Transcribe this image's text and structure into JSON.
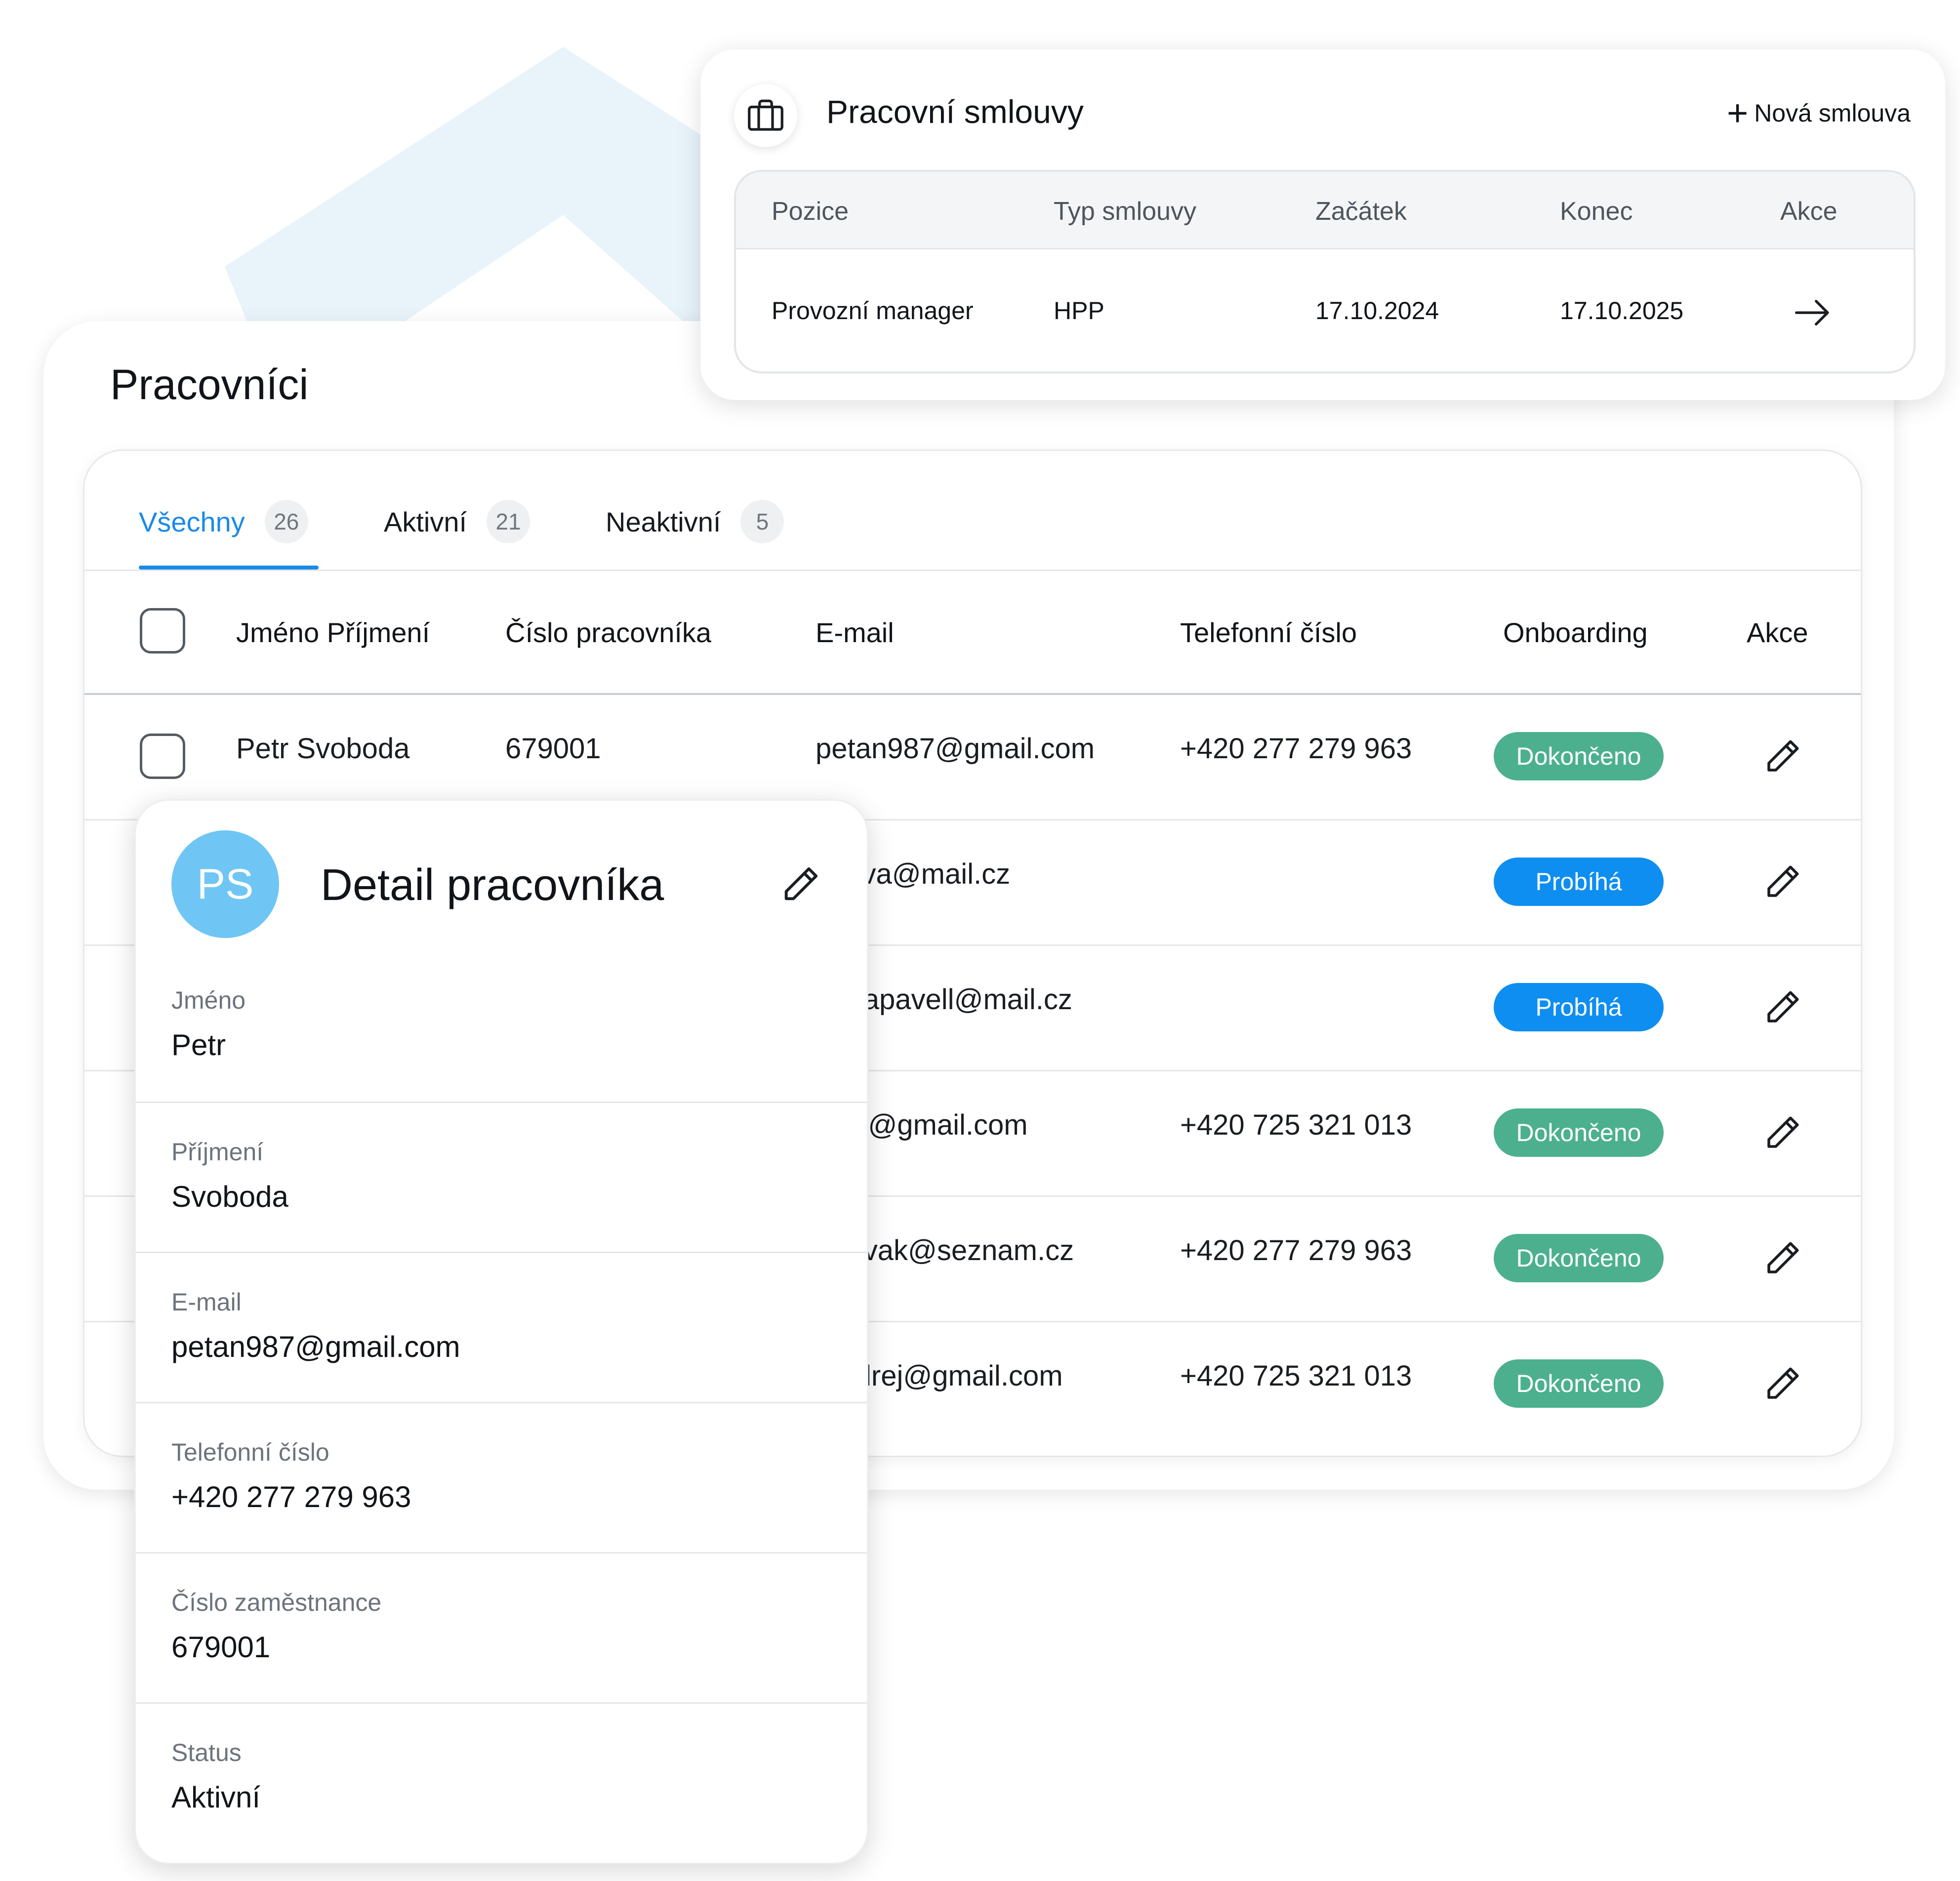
{
  "workers_panel": {
    "title": "Pracovníci",
    "tabs": [
      {
        "label": "Všechny",
        "count": "26"
      },
      {
        "label": "Aktivní",
        "count": "21"
      },
      {
        "label": "Neaktivní",
        "count": "5"
      }
    ],
    "columns": [
      "Jméno Příjmení",
      "Číslo pracovníka",
      "E-mail",
      "Telefonní číslo",
      "Onboarding",
      "Akce"
    ],
    "rows": [
      {
        "name": "Petr Svoboda",
        "number": "679001",
        "email": "petan987@gmail.com",
        "phone": "+420 277 279 963",
        "onboarding": "Dokončeno"
      },
      {
        "name": "",
        "number": "",
        "email": "ekova@mail.cz",
        "phone": "",
        "onboarding": "Probíhá"
      },
      {
        "name": "",
        "number": "",
        "email": "bodapavell@mail.cz",
        "phone": "",
        "onboarding": "Probíhá"
      },
      {
        "name": "",
        "number": "",
        "email": "poki@gmail.com",
        "phone": "+420 725 321 013",
        "onboarding": "Dokončeno"
      },
      {
        "name": "",
        "number": "",
        "email": "onovak@seznam.cz",
        "phone": "+420 277 279 963",
        "onboarding": "Dokončeno"
      },
      {
        "name": "",
        "number": "",
        "email": ".ondrej@gmail.com",
        "phone": "+420 725 321 013",
        "onboarding": "Dokončeno"
      }
    ]
  },
  "contracts": {
    "title": "Pracovní smlouvy",
    "new_label": "Nová smlouva",
    "columns": [
      "Pozice",
      "Typ smlouvy",
      "Začátek",
      "Konec",
      "Akce"
    ],
    "row": {
      "position": "Provozní manager",
      "type": "HPP",
      "start": "17.10.2024",
      "end": "17.10.2025"
    }
  },
  "detail": {
    "initials": "PS",
    "title": "Detail pracovníka",
    "fields": [
      {
        "label": "Jméno",
        "value": "Petr"
      },
      {
        "label": "Příjmení",
        "value": "Svoboda"
      },
      {
        "label": "E-mail",
        "value": "petan987@gmail.com"
      },
      {
        "label": "Telefonní číslo",
        "value": "+420 277 279 963"
      },
      {
        "label": "Číslo zaměstnance",
        "value": "679001"
      },
      {
        "label": "Status",
        "value": "Aktivní"
      }
    ]
  },
  "colors": {
    "accent_blue": "#1a8ae8",
    "badge_done": "#4cb08f",
    "badge_progress": "#0e8ef0",
    "avatar": "#6fc6f4",
    "background_shape": "#e8f3fa"
  },
  "icons": [
    "briefcase-icon",
    "plus-icon",
    "arrow-right-icon",
    "pencil-icon"
  ]
}
